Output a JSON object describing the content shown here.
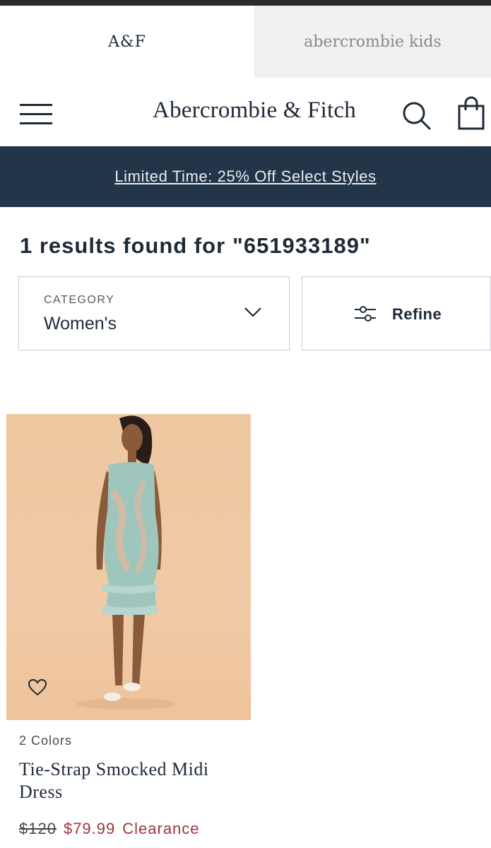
{
  "brand_tabs": {
    "af": "A&F",
    "kids": "abercrombie kids"
  },
  "header": {
    "logo": "Abercrombie & Fitch",
    "icons": [
      "hamburger-menu-icon",
      "search-icon",
      "shopping-bag-icon"
    ]
  },
  "promo": {
    "text": "Limited Time: 25% Off Select Styles"
  },
  "results": {
    "heading": "1 results found for",
    "query": "\"651933189\""
  },
  "filters": {
    "category_label": "CATEGORY",
    "category_value": "Women's",
    "refine_label": "Refine"
  },
  "product": {
    "colors": "2 Colors",
    "name": "Tie-Strap Smocked Midi Dress",
    "original_price": "$120",
    "sale_price": "$79.99",
    "tag": "Clearance",
    "wishlist_icon": "heart-icon"
  },
  "colors": {
    "navy": "#233548",
    "text": "#1f2a37",
    "sale": "#a0353d",
    "image_bg": "#eec7a0",
    "dress": "#9fc6bd"
  }
}
